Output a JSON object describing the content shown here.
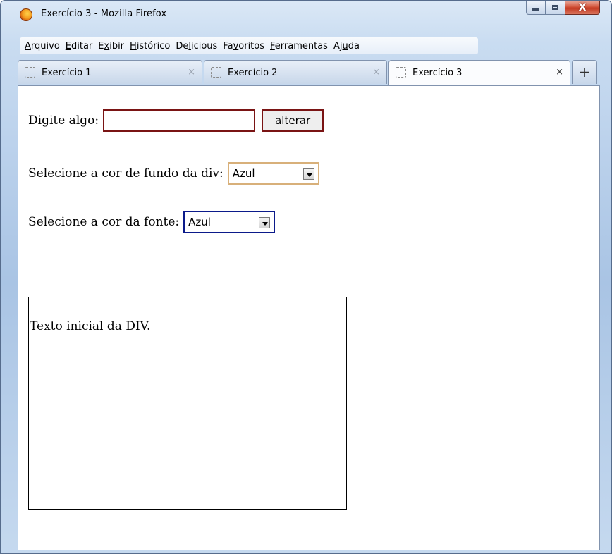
{
  "window": {
    "title": "Exercício 3 - Mozilla Firefox",
    "icon": "firefox-icon",
    "controls": {
      "minimize": "minimize-icon",
      "maximize": "maximize-icon",
      "close": "X"
    }
  },
  "menubar": [
    {
      "pre": "",
      "key": "A",
      "post": "rquivo"
    },
    {
      "pre": "",
      "key": "E",
      "post": "ditar"
    },
    {
      "pre": "E",
      "key": "x",
      "post": "ibir"
    },
    {
      "pre": "",
      "key": "H",
      "post": "istórico"
    },
    {
      "pre": "De",
      "key": "l",
      "post": "icious"
    },
    {
      "pre": "Fa",
      "key": "v",
      "post": "oritos"
    },
    {
      "pre": "",
      "key": "F",
      "post": "erramentas"
    },
    {
      "pre": "Aj",
      "key": "u",
      "post": "da"
    }
  ],
  "tabs": [
    {
      "label": "Exercício 1",
      "close": "×",
      "active": false
    },
    {
      "label": "Exercício 2",
      "close": "×",
      "active": false
    },
    {
      "label": "Exercício 3",
      "close": "×",
      "active": true
    }
  ],
  "new_tab": "+",
  "page": {
    "input_label": "Digite algo:",
    "input_value": "",
    "button_label": "alterar",
    "bg_label": "Selecione a cor de fundo da div:",
    "bg_value": "Azul",
    "font_label": "Selecione a cor da fonte:",
    "font_value": "Azul",
    "div_text": "Texto inicial da DIV."
  },
  "colors": {
    "input_border": "#7a1414",
    "bg_select_border": "#d8b07a",
    "font_select_border": "#0b1a8a"
  }
}
